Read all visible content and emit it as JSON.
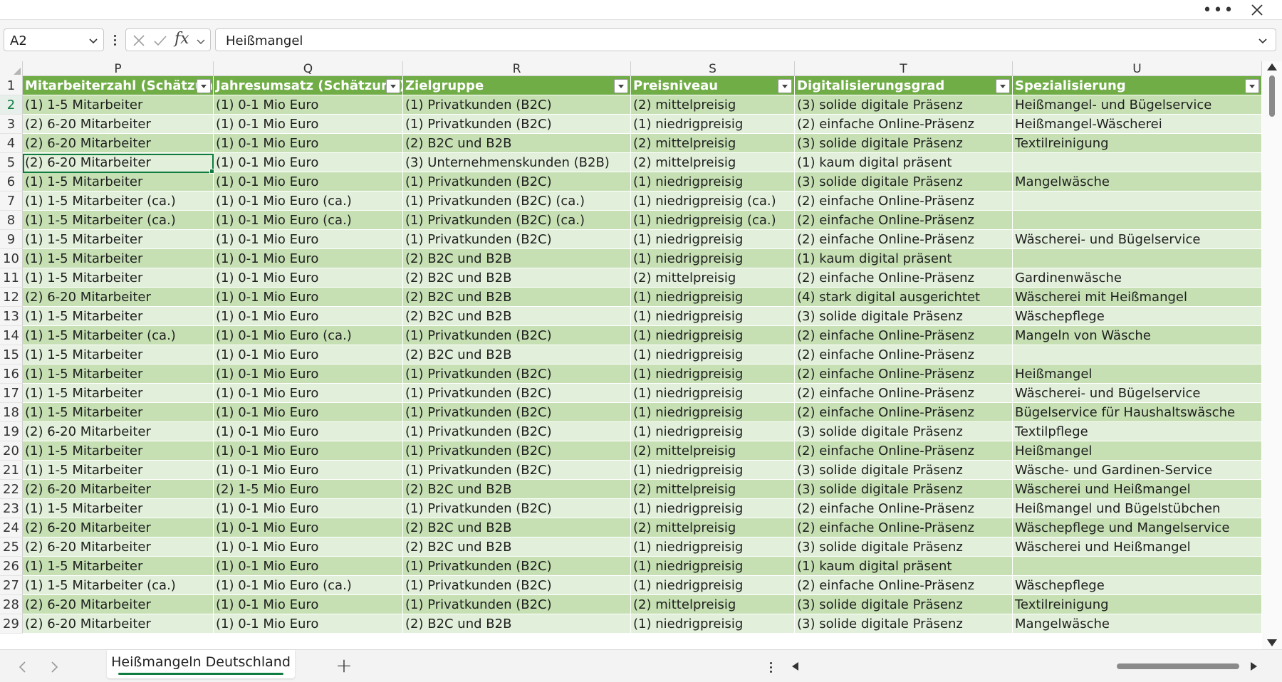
{
  "topbar": {
    "more_icon": "more-horizontal-icon",
    "close_icon": "close-icon"
  },
  "formula_bar": {
    "name_box": "A2",
    "fx_label": "fx",
    "content": "Heißmangel"
  },
  "columns": [
    {
      "letter": "P"
    },
    {
      "letter": "Q"
    },
    {
      "letter": "R"
    },
    {
      "letter": "S"
    },
    {
      "letter": "T"
    },
    {
      "letter": "U"
    }
  ],
  "header_row": {
    "num": "1",
    "cells": [
      "Mitarbeiterzahl (Schätzung)",
      "Jahresumsatz (Schätzung)",
      "Zielgruppe",
      "Preisniveau",
      "Digitalisierungsgrad",
      "Spezialisierung"
    ]
  },
  "rows": [
    {
      "num": "2",
      "cells": [
        "(1) 1-5 Mitarbeiter",
        "(1) 0-1 Mio Euro",
        "(1) Privatkunden (B2C)",
        "(2) mittelpreisig",
        "(3) solide digitale Präsenz",
        "Heißmangel- und Bügelservice"
      ]
    },
    {
      "num": "3",
      "cells": [
        "(2) 6-20 Mitarbeiter",
        "(1) 0-1 Mio Euro",
        "(1) Privatkunden (B2C)",
        "(1) niedrigpreisig",
        "(2) einfache Online-Präsenz",
        "Heißmangel-Wäscherei"
      ]
    },
    {
      "num": "4",
      "cells": [
        "(2) 6-20 Mitarbeiter",
        "(1) 0-1 Mio Euro",
        "(2) B2C und B2B",
        "(2) mittelpreisig",
        "(3) solide digitale Präsenz",
        "Textilreinigung"
      ]
    },
    {
      "num": "5",
      "cells": [
        "(2) 6-20 Mitarbeiter",
        "(1) 0-1 Mio Euro",
        "(3) Unternehmenskunden (B2B)",
        "(2) mittelpreisig",
        "(1) kaum digital präsent",
        ""
      ]
    },
    {
      "num": "6",
      "cells": [
        "(1) 1-5 Mitarbeiter",
        "(1) 0-1 Mio Euro",
        "(1) Privatkunden (B2C)",
        "(1) niedrigpreisig",
        "(3) solide digitale Präsenz",
        "Mangelwäsche"
      ]
    },
    {
      "num": "7",
      "cells": [
        "(1) 1-5 Mitarbeiter (ca.)",
        "(1) 0-1 Mio Euro (ca.)",
        "(1) Privatkunden (B2C) (ca.)",
        "(1) niedrigpreisig (ca.)",
        "(2) einfache Online-Präsenz",
        ""
      ]
    },
    {
      "num": "8",
      "cells": [
        "(1) 1-5 Mitarbeiter (ca.)",
        "(1) 0-1 Mio Euro (ca.)",
        "(1) Privatkunden (B2C) (ca.)",
        "(1) niedrigpreisig (ca.)",
        "(2) einfache Online-Präsenz",
        ""
      ]
    },
    {
      "num": "9",
      "cells": [
        "(1) 1-5 Mitarbeiter",
        "(1) 0-1 Mio Euro",
        "(1) Privatkunden (B2C)",
        "(1) niedrigpreisig",
        "(2) einfache Online-Präsenz",
        "Wäscherei- und Bügelservice"
      ]
    },
    {
      "num": "10",
      "cells": [
        "(1) 1-5 Mitarbeiter",
        "(1) 0-1 Mio Euro",
        "(2) B2C und B2B",
        "(1) niedrigpreisig",
        "(1) kaum digital präsent",
        ""
      ]
    },
    {
      "num": "11",
      "cells": [
        "(1) 1-5 Mitarbeiter",
        "(1) 0-1 Mio Euro",
        "(2) B2C und B2B",
        "(2) mittelpreisig",
        "(2) einfache Online-Präsenz",
        "Gardinenwäsche"
      ]
    },
    {
      "num": "12",
      "cells": [
        "(2) 6-20 Mitarbeiter",
        "(1) 0-1 Mio Euro",
        "(2) B2C und B2B",
        "(1) niedrigpreisig",
        "(4) stark digital ausgerichtet",
        "Wäscherei mit Heißmangel"
      ]
    },
    {
      "num": "13",
      "cells": [
        "(1) 1-5 Mitarbeiter",
        "(1) 0-1 Mio Euro",
        "(2) B2C und B2B",
        "(1) niedrigpreisig",
        "(3) solide digitale Präsenz",
        "Wäschepflege"
      ]
    },
    {
      "num": "14",
      "cells": [
        "(1) 1-5 Mitarbeiter (ca.)",
        "(1) 0-1 Mio Euro (ca.)",
        "(1) Privatkunden (B2C)",
        "(1) niedrigpreisig",
        "(2) einfache Online-Präsenz",
        "Mangeln von Wäsche"
      ]
    },
    {
      "num": "15",
      "cells": [
        "(1) 1-5 Mitarbeiter",
        "(1) 0-1 Mio Euro",
        "(2) B2C und B2B",
        "(1) niedrigpreisig",
        "(2) einfache Online-Präsenz",
        ""
      ]
    },
    {
      "num": "16",
      "cells": [
        "(1) 1-5 Mitarbeiter",
        "(1) 0-1 Mio Euro",
        "(1) Privatkunden (B2C)",
        "(1) niedrigpreisig",
        "(2) einfache Online-Präsenz",
        "Heißmangel"
      ]
    },
    {
      "num": "17",
      "cells": [
        "(1) 1-5 Mitarbeiter",
        "(1) 0-1 Mio Euro",
        "(1) Privatkunden (B2C)",
        "(1) niedrigpreisig",
        "(2) einfache Online-Präsenz",
        "Wäscherei- und Bügelservice"
      ]
    },
    {
      "num": "18",
      "cells": [
        "(1) 1-5 Mitarbeiter",
        "(1) 0-1 Mio Euro",
        "(1) Privatkunden (B2C)",
        "(1) niedrigpreisig",
        "(2) einfache Online-Präsenz",
        "Bügelservice für Haushaltswäsche"
      ]
    },
    {
      "num": "19",
      "cells": [
        "(2) 6-20 Mitarbeiter",
        "(1) 0-1 Mio Euro",
        "(1) Privatkunden (B2C)",
        "(1) niedrigpreisig",
        "(3) solide digitale Präsenz",
        "Textilpflege"
      ]
    },
    {
      "num": "20",
      "cells": [
        "(1) 1-5 Mitarbeiter",
        "(1) 0-1 Mio Euro",
        "(1) Privatkunden (B2C)",
        "(2) mittelpreisig",
        "(2) einfache Online-Präsenz",
        "Heißmangel"
      ]
    },
    {
      "num": "21",
      "cells": [
        "(1) 1-5 Mitarbeiter",
        "(1) 0-1 Mio Euro",
        "(1) Privatkunden (B2C)",
        "(1) niedrigpreisig",
        "(3) solide digitale Präsenz",
        "Wäsche- und Gardinen-Service"
      ]
    },
    {
      "num": "22",
      "cells": [
        "(2) 6-20 Mitarbeiter",
        "(2) 1-5 Mio Euro",
        "(2) B2C und B2B",
        "(2) mittelpreisig",
        "(3) solide digitale Präsenz",
        "Wäscherei und Heißmangel"
      ]
    },
    {
      "num": "23",
      "cells": [
        "(1) 1-5 Mitarbeiter",
        "(1) 0-1 Mio Euro",
        "(1) Privatkunden (B2C)",
        "(1) niedrigpreisig",
        "(2) einfache Online-Präsenz",
        "Heißmangel und Bügelstübchen"
      ]
    },
    {
      "num": "24",
      "cells": [
        "(2) 6-20 Mitarbeiter",
        "(1) 0-1 Mio Euro",
        "(2) B2C und B2B",
        "(2) mittelpreisig",
        "(2) einfache Online-Präsenz",
        "Wäschepflege und Mangelservice"
      ]
    },
    {
      "num": "25",
      "cells": [
        "(2) 6-20 Mitarbeiter",
        "(1) 0-1 Mio Euro",
        "(2) B2C und B2B",
        "(1) niedrigpreisig",
        "(3) solide digitale Präsenz",
        "Wäscherei und Heißmangel"
      ]
    },
    {
      "num": "26",
      "cells": [
        "(1) 1-5 Mitarbeiter",
        "(1) 0-1 Mio Euro",
        "(1) Privatkunden (B2C)",
        "(1) niedrigpreisig",
        "(1) kaum digital präsent",
        ""
      ]
    },
    {
      "num": "27",
      "cells": [
        "(1) 1-5 Mitarbeiter (ca.)",
        "(1) 0-1 Mio Euro (ca.)",
        "(1) Privatkunden (B2C)",
        "(1) niedrigpreisig",
        "(2) einfache Online-Präsenz",
        "Wäschepflege"
      ]
    },
    {
      "num": "28",
      "cells": [
        "(2) 6-20 Mitarbeiter",
        "(1) 0-1 Mio Euro",
        "(1) Privatkunden (B2C)",
        "(2) mittelpreisig",
        "(3) solide digitale Präsenz",
        "Textilreinigung"
      ]
    },
    {
      "num": "29",
      "cells": [
        "(2) 6-20 Mitarbeiter",
        "(1) 0-1 Mio Euro",
        "(2) B2C und B2B",
        "(1) niedrigpreisig",
        "(3) solide digitale Präsenz",
        "Mangelwäsche"
      ]
    }
  ],
  "sheet_tabs": {
    "active": "Heißmangeln Deutschland",
    "add_label": "+"
  },
  "colors": {
    "header_fill": "#70ad47",
    "band_dark": "#c6e0b4",
    "band_light": "#e2efda",
    "accent": "#107c41"
  }
}
